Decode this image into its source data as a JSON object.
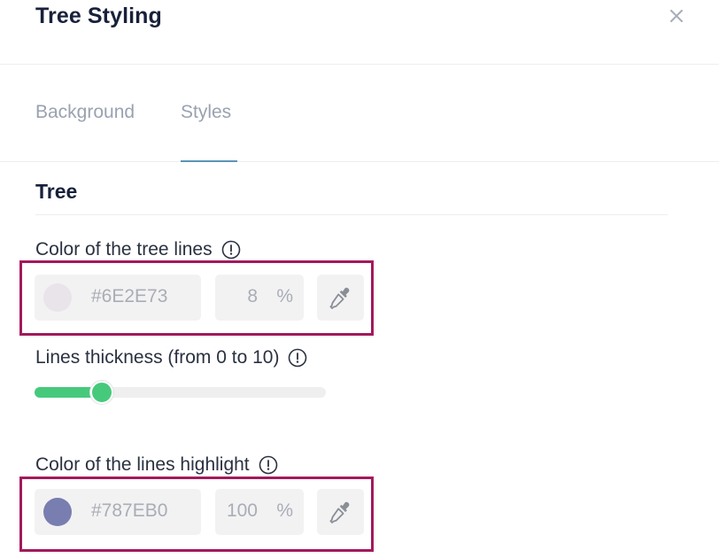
{
  "dialog": {
    "title": "Tree Styling"
  },
  "tabs": [
    {
      "label": "Background",
      "active": false
    },
    {
      "label": "Styles",
      "active": true
    }
  ],
  "section": {
    "title": "Tree"
  },
  "tree_lines": {
    "label": "Color of the tree lines",
    "hex": "#6E2E73",
    "opacity": "8",
    "percent_symbol": "%",
    "swatch_color": "#e9e4e9"
  },
  "thickness": {
    "label": "Lines thickness (from 0 to 10)",
    "value": 2.3,
    "min": 0,
    "max": 10,
    "accent_color": "#47c97c"
  },
  "lines_highlight": {
    "label": "Color of the lines highlight",
    "hex": "#787EB0",
    "opacity": "100",
    "percent_symbol": "%",
    "swatch_color": "#787EB0"
  },
  "annotation_color": "#a3195b",
  "icons": {
    "close": "close-icon",
    "info": "info-icon",
    "eyedropper": "eyedropper-icon"
  }
}
